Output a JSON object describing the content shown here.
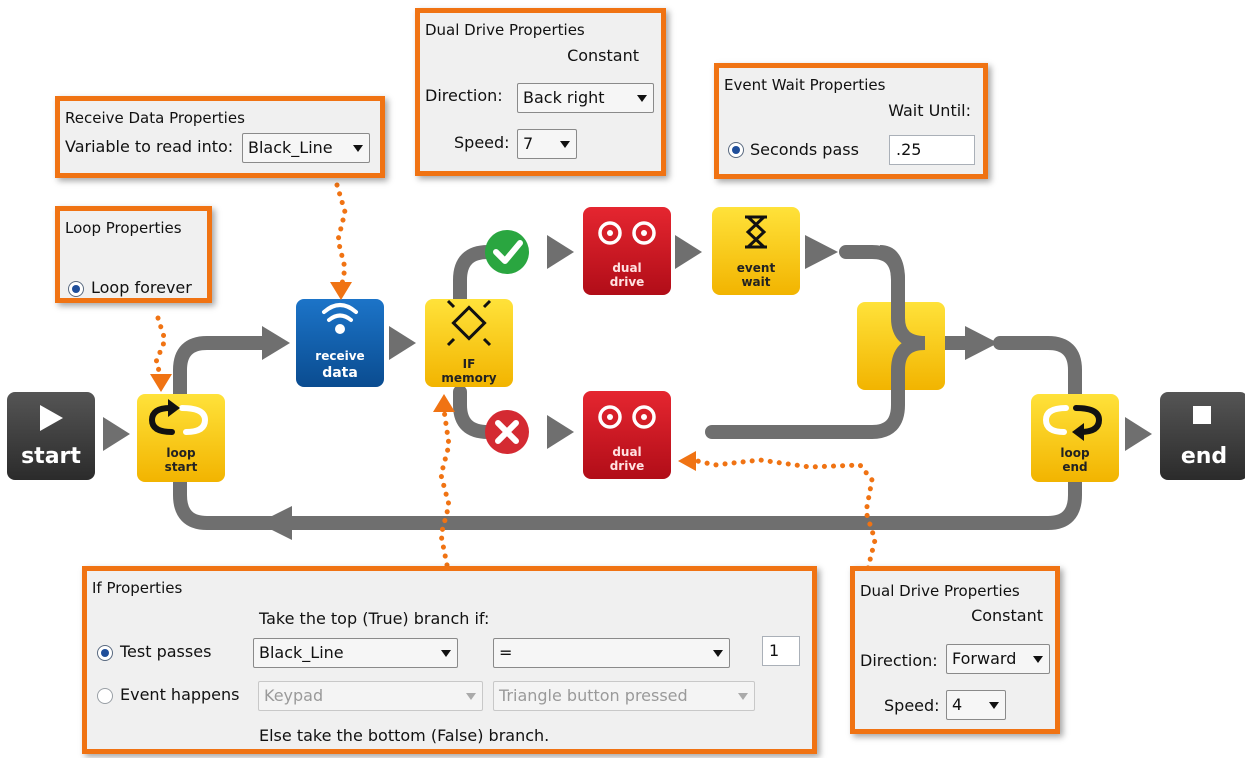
{
  "blocks": {
    "start": "start",
    "loop_start": [
      "loop",
      "start"
    ],
    "receive_data": [
      "receive",
      "data"
    ],
    "if_memory": [
      "IF",
      "memory"
    ],
    "dual_drive_top": [
      "dual",
      "drive"
    ],
    "event_wait": [
      "event",
      "wait"
    ],
    "dual_drive_bottom": [
      "dual",
      "drive"
    ],
    "loop_end": [
      "loop",
      "end"
    ],
    "end": "end"
  },
  "colors": {
    "accent": "#f07313",
    "yellow": "#f5c800",
    "red": "#c8101c",
    "blue": "#0c5aa5",
    "dark": "#3a3a3a",
    "wire": "#6f6f6f",
    "true_green": "#2aa640",
    "false_red": "#d42a32"
  },
  "icons": {
    "start": "play-icon",
    "end": "stop-icon",
    "loop": "loop-arrow-icon",
    "receive": "wireless-icon",
    "if": "chip-icon",
    "drive": "dual-rotate-icon",
    "wait": "hourglass-icon",
    "true_branch": "check-icon",
    "false_branch": "cross-icon"
  },
  "receive_panel": {
    "title": "Receive Data Properties",
    "variable_label": "Variable to read into:",
    "variable_value": "Black_Line"
  },
  "loop_panel": {
    "title": "Loop Properties",
    "option": "Loop forever",
    "selected": true
  },
  "dual_drive_top_panel": {
    "title": "Dual Drive Properties",
    "mode": "Constant",
    "direction_label": "Direction:",
    "direction_value": "Back right",
    "speed_label": "Speed:",
    "speed_value": "7"
  },
  "event_wait_panel": {
    "title": "Event Wait Properties",
    "wait_until_label": "Wait Until:",
    "option": "Seconds pass",
    "value": ".25"
  },
  "if_panel": {
    "title": "If Properties",
    "instruction": "Take the top (True) branch if:",
    "test_label": "Test passes",
    "test_variable": "Black_Line",
    "test_operator": "=",
    "test_value": "1",
    "event_label": "Event happens",
    "event_source": "Keypad",
    "event_value": "Triangle button pressed",
    "else_text": "Else take the bottom (False) branch."
  },
  "dual_drive_bottom_panel": {
    "title": "Dual Drive Properties",
    "mode": "Constant",
    "direction_label": "Direction:",
    "direction_value": "Forward",
    "speed_label": "Speed:",
    "speed_value": "4"
  }
}
